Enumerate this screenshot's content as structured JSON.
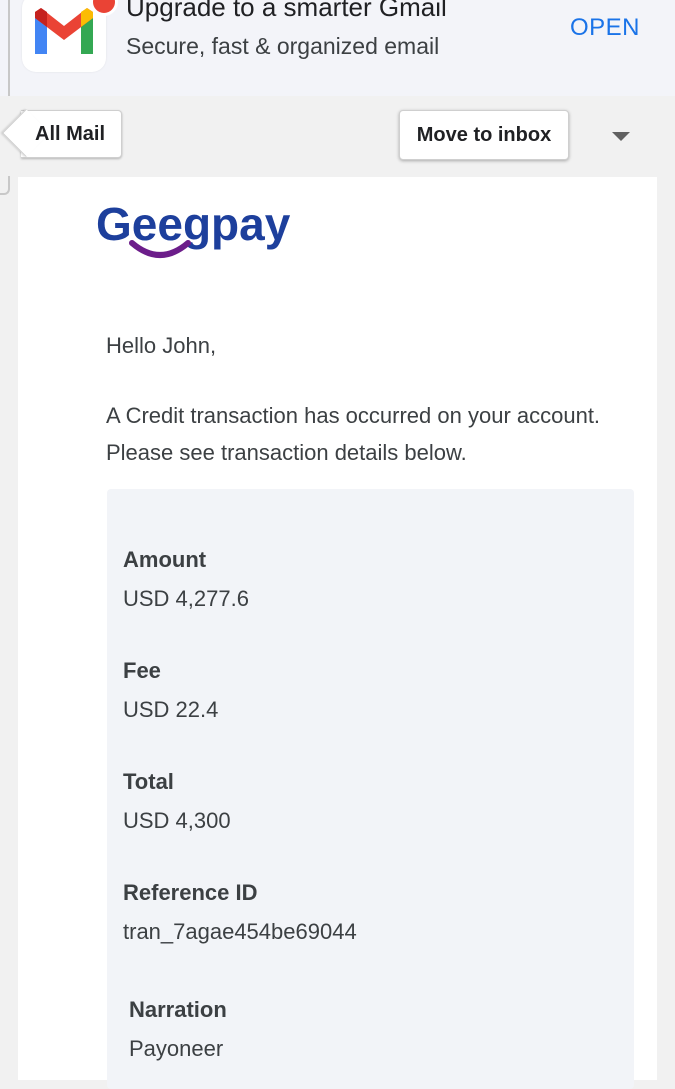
{
  "banner": {
    "title": "Upgrade to a smarter Gmail",
    "subtitle": "Secure, fast & organized email",
    "open_label": "OPEN"
  },
  "toolbar": {
    "all_mail_label": "All Mail",
    "move_to_inbox_label": "Move to inbox"
  },
  "email": {
    "brand": "Geegpay",
    "greeting": "Hello John,",
    "intro": "A Credit transaction has occurred on your account. Please see transaction details below.",
    "fields": [
      {
        "label": "Amount",
        "value": "USD 4,277.6"
      },
      {
        "label": "Fee",
        "value": "USD 22.4"
      },
      {
        "label": "Total",
        "value": "USD 4,300"
      },
      {
        "label": "Reference ID",
        "value": "tran_7agae454be69044"
      },
      {
        "label": "Narration",
        "value": "Payoneer"
      }
    ]
  },
  "colors": {
    "accent": "#1a73e8",
    "brand_blue": "#1d3f9c",
    "brand_smile": "#6c1d8a"
  }
}
